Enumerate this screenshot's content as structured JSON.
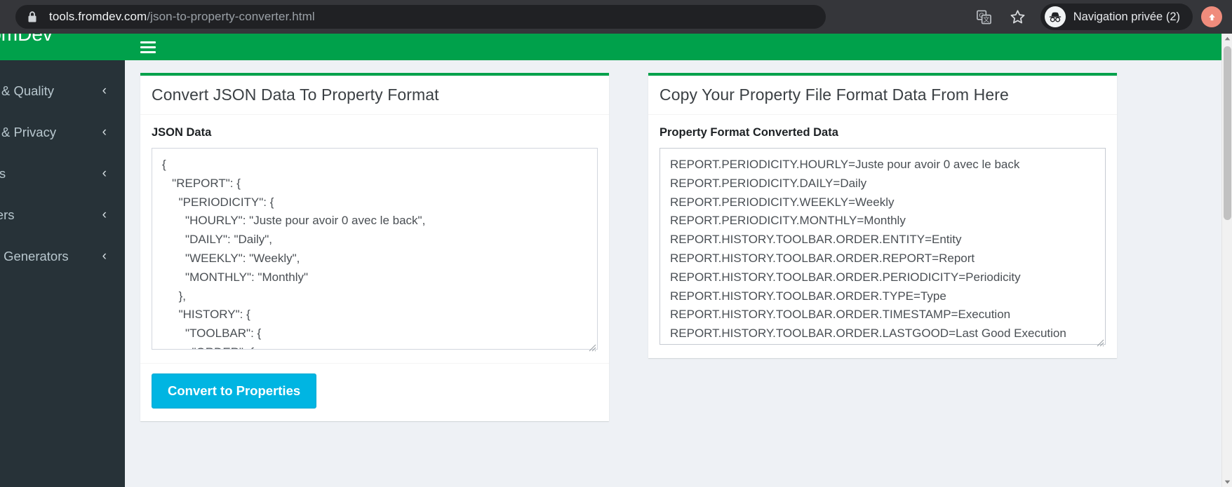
{
  "browser": {
    "url_host": "tools.fromdev.com",
    "url_path": "/json-to-property-converter.html",
    "lock_icon": "lock-icon",
    "translate_icon": "translate-icon",
    "bookmark_icon": "star-icon",
    "incognito_label": "Navigation privée (2)",
    "incognito_icon": "incognito-hat-glasses-icon",
    "update_icon": "update-arrow-icon"
  },
  "sidebar": {
    "brand": ".FromDev",
    "items": [
      {
        "label": "Security & Quality",
        "chevron": "‹"
      },
      {
        "label": "Security & Privacy",
        "chevron": "‹"
      },
      {
        "label": "Encoders",
        "chevron": "‹"
      },
      {
        "label": "Converters",
        "chevron": "‹"
      },
      {
        "label": "Random Generators",
        "chevron": "‹"
      }
    ]
  },
  "app_header": {
    "menu_toggle_icon": "hamburger-icon"
  },
  "left_panel": {
    "title": "Convert JSON Data To Property Format",
    "field_label": "JSON Data",
    "json_value": "{\n   \"REPORT\": {\n     \"PERIODICITY\": {\n       \"HOURLY\": \"Juste pour avoir 0 avec le back\",\n       \"DAILY\": \"Daily\",\n       \"WEEKLY\": \"Weekly\",\n       \"MONTHLY\": \"Monthly\"\n     },\n     \"HISTORY\": {\n       \"TOOLBAR\": {\n         \"ORDER\": {",
    "button_label": "Convert to Properties"
  },
  "right_panel": {
    "title": "Copy Your Property File Format Data From Here",
    "field_label": "Property Format Converted Data",
    "output_value": "REPORT.PERIODICITY.HOURLY=Juste pour avoir 0 avec le back\nREPORT.PERIODICITY.DAILY=Daily\nREPORT.PERIODICITY.WEEKLY=Weekly\nREPORT.PERIODICITY.MONTHLY=Monthly\nREPORT.HISTORY.TOOLBAR.ORDER.ENTITY=Entity\nREPORT.HISTORY.TOOLBAR.ORDER.REPORT=Report\nREPORT.HISTORY.TOOLBAR.ORDER.PERIODICITY=Periodicity\nREPORT.HISTORY.TOOLBAR.ORDER.TYPE=Type\nREPORT.HISTORY.TOOLBAR.ORDER.TIMESTAMP=Execution\nREPORT.HISTORY.TOOLBAR.ORDER.LASTGOOD=Last Good Execution"
  },
  "colors": {
    "brand_green": "#00a14b",
    "sidebar_dark": "#273238",
    "button_blue": "#00b5e2",
    "chrome_dark": "#35363a",
    "omnibox_dark": "#202124"
  }
}
